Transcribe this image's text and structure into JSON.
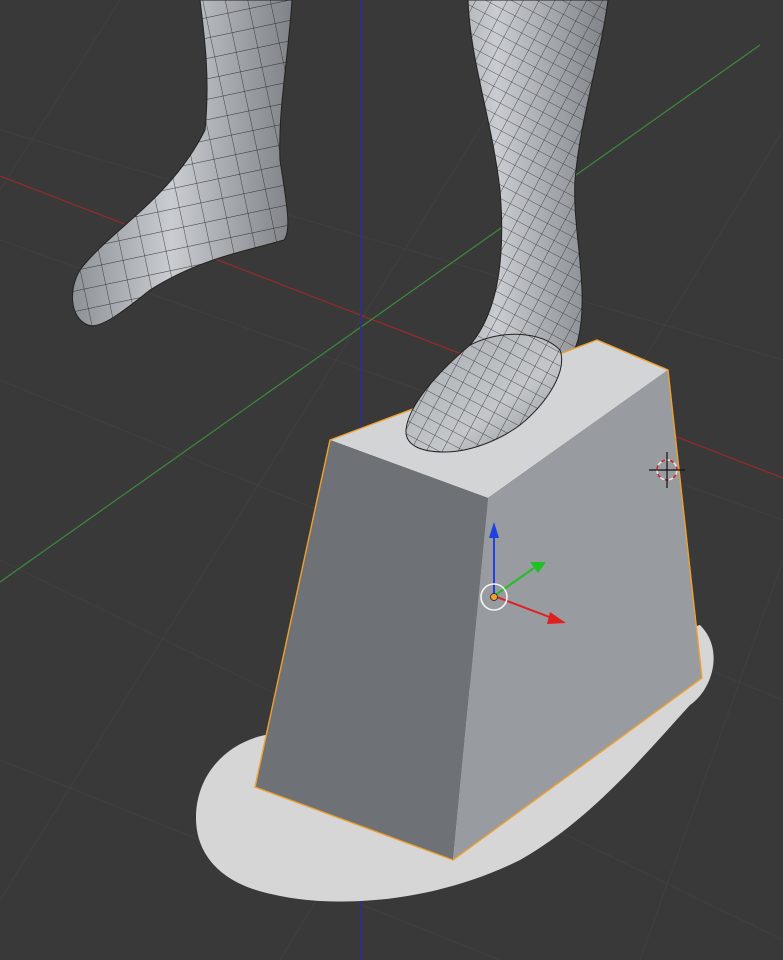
{
  "colors": {
    "background": "#393939",
    "grid": "#404040",
    "x_axis": "#9a2a2a",
    "y_axis": "#3c8a3c",
    "z_axis": "#2c2c9c",
    "selection_outline": "#f0a030",
    "mesh_face": "#b9bcbf",
    "mesh_wire": "#202020",
    "shadow": "#d4d4d4",
    "gizmo_x": "#e02020",
    "gizmo_y": "#20c020",
    "gizmo_z": "#2040e0",
    "origin": "#f0a030"
  },
  "icons": {
    "cursor": "3d-cursor-icon",
    "gizmo": "transform-gizmo-icon",
    "origin": "object-origin-icon"
  }
}
